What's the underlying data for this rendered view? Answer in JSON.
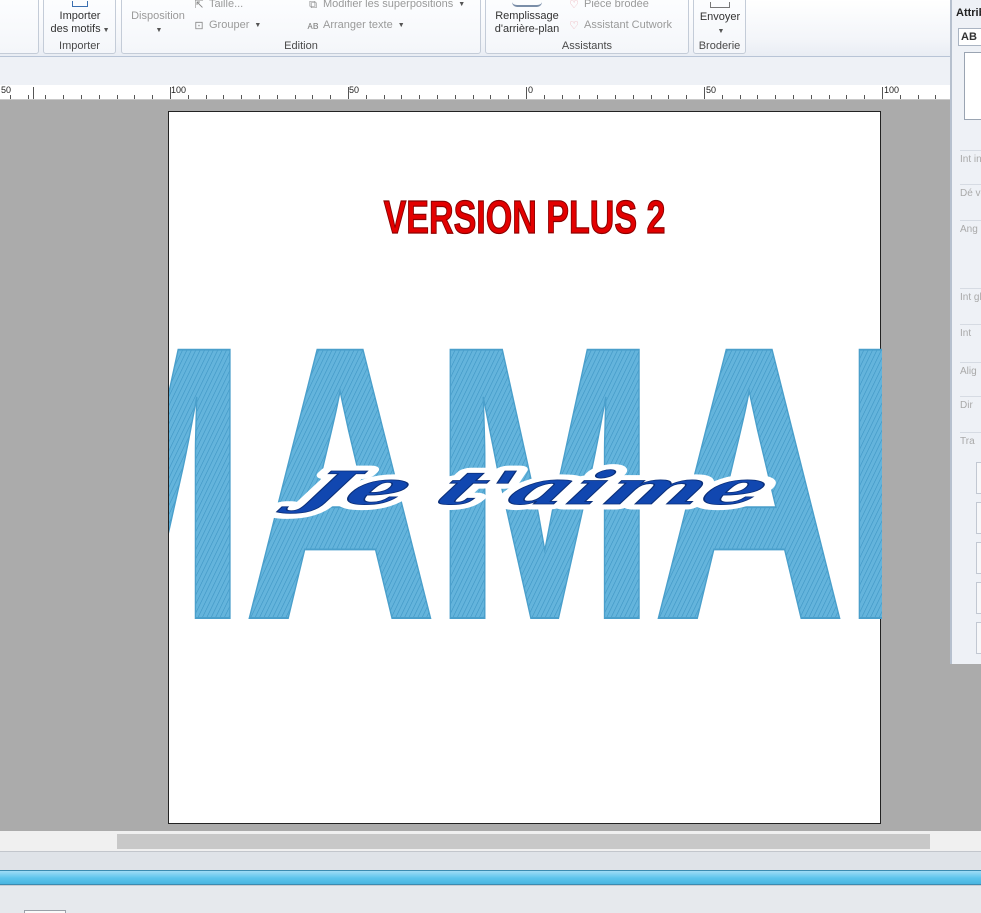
{
  "ribbon": {
    "importer": {
      "button_line1": "Importer",
      "button_line2": "des motifs",
      "group_label": "Importer"
    },
    "edition": {
      "disposition": "Disposition",
      "taille": "Taille...",
      "grouper": "Grouper",
      "modifier": "Modifier les superpositions",
      "arranger": "Arranger texte",
      "group_label": "Edition"
    },
    "assistants": {
      "remplissage_line1": "Remplissage",
      "remplissage_line2": "d'arrière-plan",
      "piece": "Pièce brodée",
      "cutwork": "Assistant Cutwork",
      "group_label": "Assistants"
    },
    "broderie": {
      "envoyer": "Envoyer",
      "group_label": "Broderie"
    }
  },
  "attributes_panel": {
    "title": "Attributs",
    "tab": "AB",
    "rows": [
      "Int ind",
      "Dé ver",
      "Ang",
      "Int glo",
      "Int",
      "Alig",
      "Dir",
      "Tra"
    ]
  },
  "ruler": {
    "labels": [
      "50",
      "100",
      "50",
      "0",
      "50",
      "100"
    ]
  },
  "canvas": {
    "title_text": "VERSION PLUS 2",
    "main_word": "MAMAN",
    "script_text": "Je t'aime",
    "colors": {
      "title": "#e30000",
      "maman": "#5fb0d8",
      "script": "#1147b0"
    }
  },
  "status": {
    "progress_color": "#5cc4ec"
  }
}
